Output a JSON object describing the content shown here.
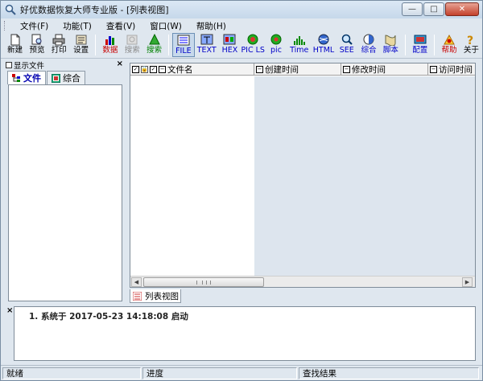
{
  "window": {
    "title": "好优数据恢复大师专业版 - [列表视图]",
    "controls": {
      "minimize": "—",
      "maximize": "□",
      "close": "✕"
    }
  },
  "menubar": {
    "items": [
      "文件(F)",
      "功能(T)",
      "查看(V)",
      "窗口(W)",
      "帮助(H)"
    ]
  },
  "toolbar": {
    "buttons": [
      {
        "label": "新建",
        "icon": "new-file-icon"
      },
      {
        "label": "预览",
        "icon": "preview-icon"
      },
      {
        "label": "打印",
        "icon": "print-icon"
      },
      {
        "label": "设置",
        "icon": "settings-icon"
      },
      {
        "label": "数据",
        "icon": "data-chart-icon"
      },
      {
        "label": "搜索",
        "icon": "search-disabled-icon"
      },
      {
        "label": "搜索",
        "icon": "search-tree-icon"
      },
      {
        "label": "FILE",
        "icon": "file-mode-icon"
      },
      {
        "label": "TEXT",
        "icon": "text-mode-icon"
      },
      {
        "label": "HEX",
        "icon": "hex-mode-icon"
      },
      {
        "label": "PIC LS",
        "icon": "picture-list-icon"
      },
      {
        "label": "pic",
        "icon": "picture-icon"
      },
      {
        "label": "Time",
        "icon": "time-chart-icon"
      },
      {
        "label": "HTML",
        "icon": "html-globe-icon"
      },
      {
        "label": "SEE",
        "icon": "see-magnifier-icon"
      },
      {
        "label": "综合",
        "icon": "composite-icon"
      },
      {
        "label": "脚本",
        "icon": "script-icon"
      },
      {
        "label": "配置",
        "icon": "config-icon"
      },
      {
        "label": "帮助",
        "icon": "help-icon"
      },
      {
        "label": "关于",
        "icon": "about-icon"
      }
    ]
  },
  "left_panel": {
    "title": "显示文件",
    "close": "×",
    "tabs": [
      "文件",
      "综合"
    ]
  },
  "list_view": {
    "columns": [
      "文件名",
      "创建时间",
      "修改时间",
      "访问时间"
    ],
    "rows": []
  },
  "view_tab": {
    "label": "列表视图"
  },
  "log": {
    "close": "×",
    "lines": [
      "1. 系统于 2017-05-23 14:18:08 启动"
    ]
  },
  "statusbar": {
    "segments": [
      "就绪",
      "进度",
      "查找结果"
    ]
  },
  "colors": {
    "window_bg": "#dfe7ef",
    "titlebar": "#c6d8ea",
    "close_button": "#c3412b",
    "label_blue": "#0000c8",
    "label_red": "#c80000"
  }
}
